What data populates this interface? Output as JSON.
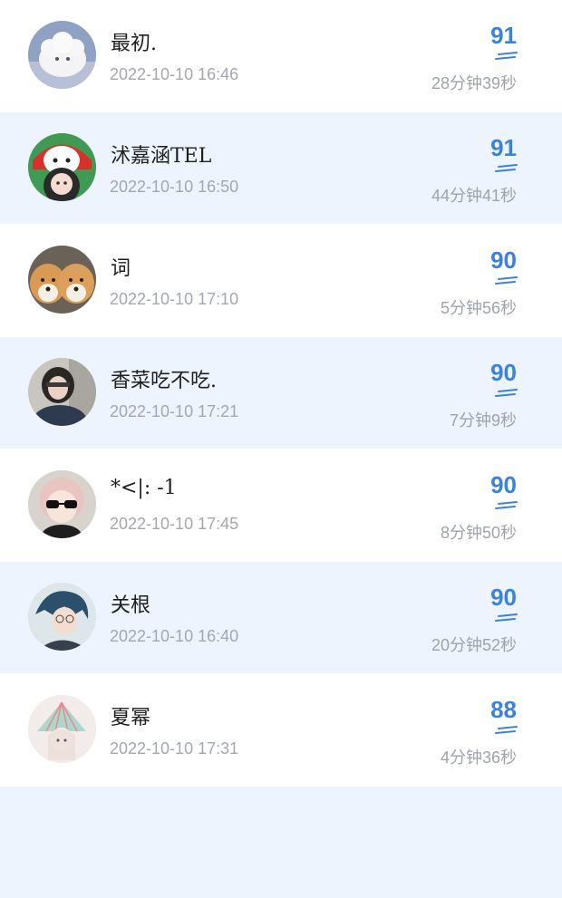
{
  "rows": [
    {
      "name": "最初.",
      "time": "2022-10-10 16:46",
      "score": "91",
      "duration": "28分钟39秒",
      "avatar": "plush-toy-avatar"
    },
    {
      "name": "沭嘉涵TEL",
      "time": "2022-10-10 16:50",
      "score": "91",
      "duration": "44分钟41秒",
      "avatar": "anime-girl-avatar"
    },
    {
      "name": "词",
      "time": "2022-10-10 17:10",
      "score": "90",
      "duration": "5分钟56秒",
      "avatar": "shiba-dogs-avatar"
    },
    {
      "name": "香菜吃不吃.",
      "time": "2022-10-10 17:21",
      "score": "90",
      "duration": "7分钟9秒",
      "avatar": "girl-photo-avatar"
    },
    {
      "name": "*<|: -1",
      "time": "2022-10-10 17:45",
      "score": "90",
      "duration": "8分钟50秒",
      "avatar": "sunglasses-girl-avatar"
    },
    {
      "name": "关根",
      "time": "2022-10-10 16:40",
      "score": "90",
      "duration": "20分钟52秒",
      "avatar": "anime-boy-avatar"
    },
    {
      "name": "夏幂",
      "time": "2022-10-10 17:31",
      "score": "88",
      "duration": "4分钟36秒",
      "avatar": "fan-girl-avatar"
    }
  ],
  "colors": {
    "score": "#3a82dc",
    "alt_row": "#eef4fd",
    "meta_text": "#a3a8b0"
  }
}
